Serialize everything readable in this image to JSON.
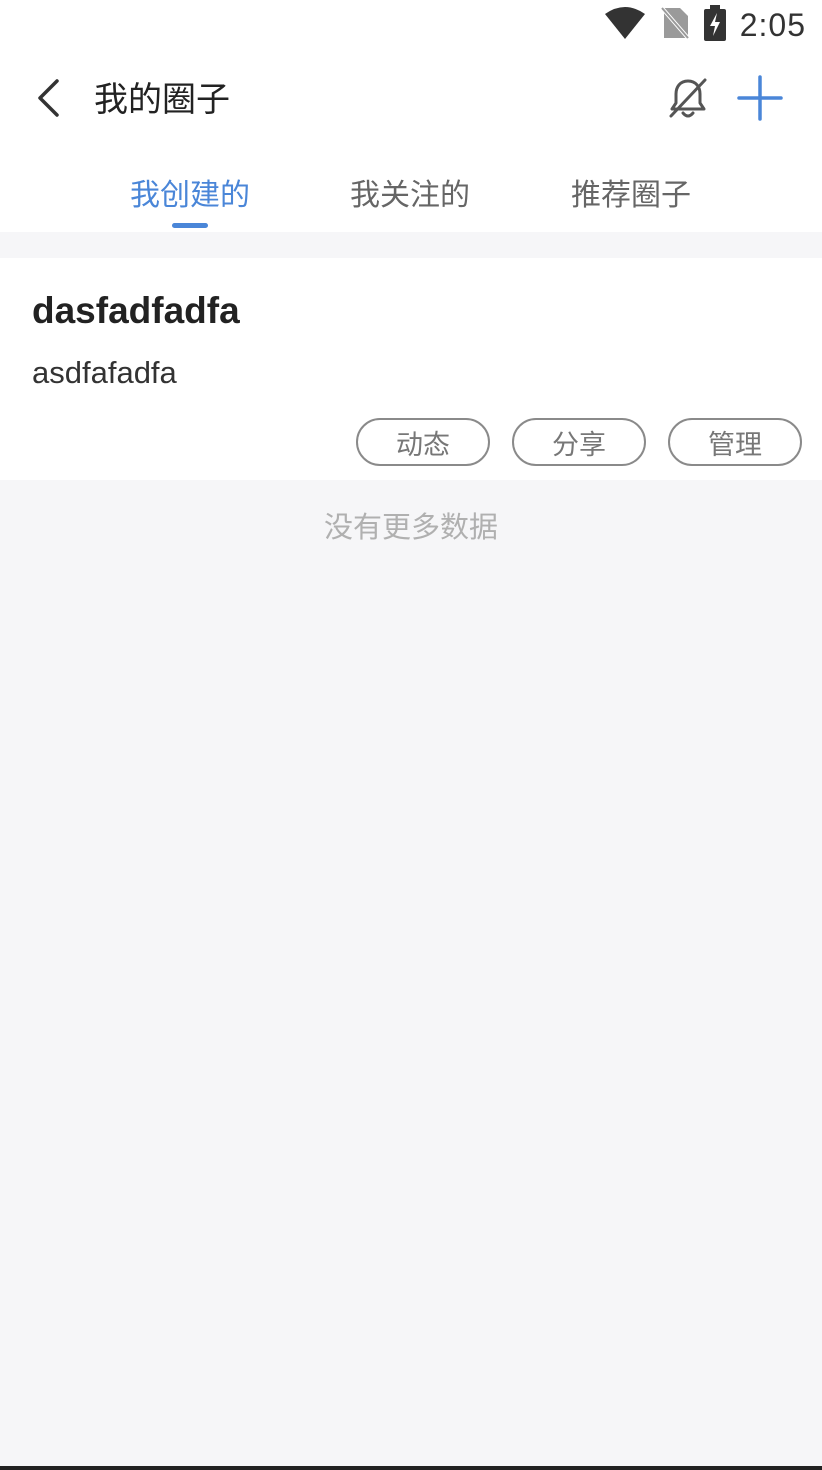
{
  "status_bar": {
    "time": "2:05",
    "icons": [
      "wifi-icon",
      "no-sim-icon",
      "battery-charging-icon"
    ]
  },
  "header": {
    "title": "我的圈子",
    "back_icon": "chevron-left-icon",
    "mute_icon": "bell-off-icon",
    "add_icon": "plus-icon"
  },
  "tabs": [
    {
      "label": "我创建的",
      "active": true
    },
    {
      "label": "我关注的",
      "active": false
    },
    {
      "label": "推荐圈子",
      "active": false
    }
  ],
  "colors": {
    "accent": "#4a86d8",
    "background": "#f6f6f8",
    "text_primary": "#222222",
    "text_muted": "#b0b0b0"
  },
  "circles": [
    {
      "name": "dasfadfadfa",
      "description": "asdfafadfa",
      "actions": {
        "activity": "动态",
        "share": "分享",
        "manage": "管理"
      }
    }
  ],
  "list_footer": "没有更多数据"
}
